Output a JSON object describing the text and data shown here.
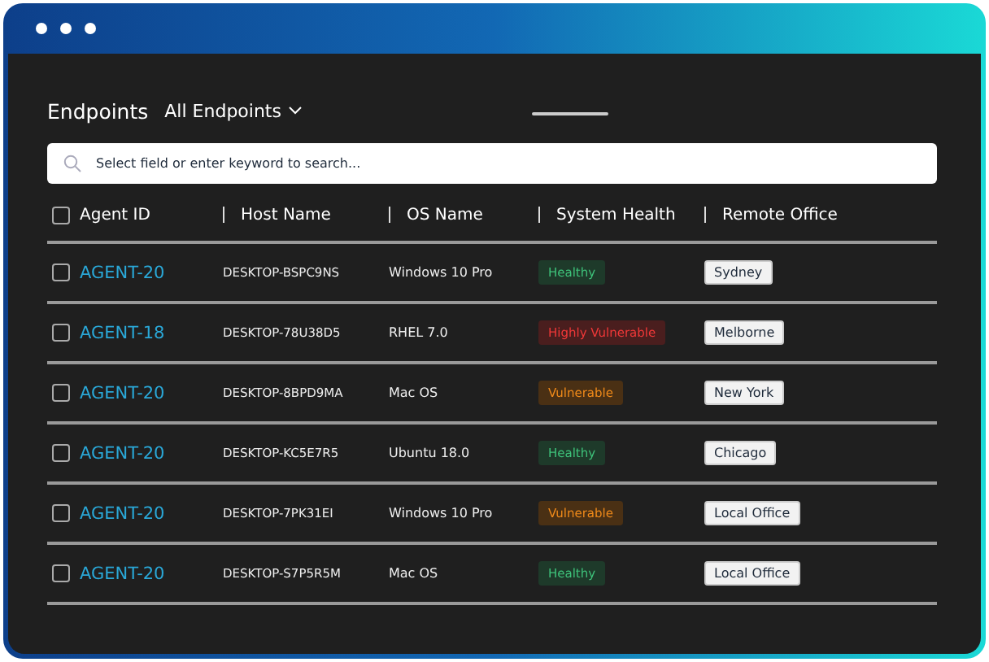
{
  "header": {
    "title": "Endpoints",
    "filter": "All Endpoints"
  },
  "search": {
    "placeholder": "Select field or enter keyword to search..."
  },
  "table": {
    "select_all": {
      "checked": false
    },
    "columns": [
      "Agent ID",
      "Host Name",
      "OS Name",
      "System Health",
      "Remote Office"
    ],
    "rows": [
      {
        "checked": false,
        "agent": "AGENT-20",
        "host": "DESKTOP-BSPC9NS",
        "os": "Windows 10 Pro",
        "health": {
          "label": "Healthy",
          "kind": "healthy"
        },
        "office": "Sydney"
      },
      {
        "checked": false,
        "agent": "AGENT-18",
        "host": "DESKTOP-78U38D5",
        "os": "RHEL 7.0",
        "health": {
          "label": "Highly Vulnerable",
          "kind": "critical"
        },
        "office": "Melborne"
      },
      {
        "checked": false,
        "agent": "AGENT-20",
        "host": "DESKTOP-8BPD9MA",
        "os": "Mac OS",
        "health": {
          "label": "Vulnerable",
          "kind": "warning"
        },
        "office": "New York"
      },
      {
        "checked": false,
        "agent": "AGENT-20",
        "host": "DESKTOP-KC5E7R5",
        "os": "Ubuntu 18.0",
        "health": {
          "label": "Healthy",
          "kind": "healthy"
        },
        "office": "Chicago"
      },
      {
        "checked": false,
        "agent": "AGENT-20",
        "host": "DESKTOP-7PK31EI",
        "os": "Windows 10 Pro",
        "health": {
          "label": "Vulnerable",
          "kind": "warning"
        },
        "office": "Local Office"
      },
      {
        "checked": false,
        "agent": "AGENT-20",
        "host": "DESKTOP-S7P5R5M",
        "os": "Mac OS",
        "health": {
          "label": "Healthy",
          "kind": "healthy"
        },
        "office": "Local Office"
      }
    ]
  }
}
